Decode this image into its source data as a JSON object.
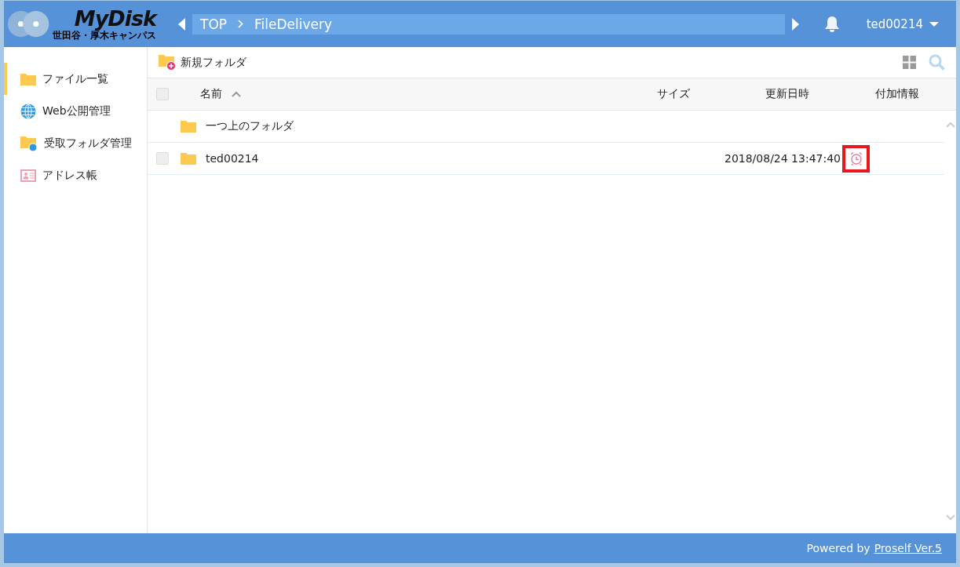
{
  "logo": {
    "title": "MyDisk",
    "subtitle": "世田谷・厚木キャンパス"
  },
  "breadcrumb": [
    {
      "label": "TOP"
    },
    {
      "label": "FileDelivery"
    }
  ],
  "user": {
    "name": "ted00214"
  },
  "sidebar": {
    "items": [
      {
        "label": "ファイル一覧",
        "kind": "files",
        "selected": true
      },
      {
        "label": "Web公開管理",
        "kind": "web",
        "selected": false
      },
      {
        "label": "受取フォルダ管理",
        "kind": "inbox",
        "selected": false
      },
      {
        "label": "アドレス帳",
        "kind": "addressbook",
        "selected": false
      }
    ]
  },
  "toolbar": {
    "new_folder": "新規フォルダ"
  },
  "table": {
    "select_all_checked": false,
    "columns": [
      {
        "label": "名前",
        "sorted": true
      },
      {
        "label": "サイズ",
        "sorted": false
      },
      {
        "label": "更新日時",
        "sorted": false
      },
      {
        "label": "付加情報",
        "sorted": false
      }
    ],
    "rows": [
      {
        "kind": "parent",
        "name": "一つ上のフォルダ"
      },
      {
        "kind": "folder",
        "name": "ted00214",
        "modified": "2018/08/24 13:47:40",
        "checked": false,
        "alarm": true,
        "highlighted": true
      }
    ]
  },
  "footer": {
    "prefix": "Powered by",
    "link": "Proself Ver.5"
  }
}
